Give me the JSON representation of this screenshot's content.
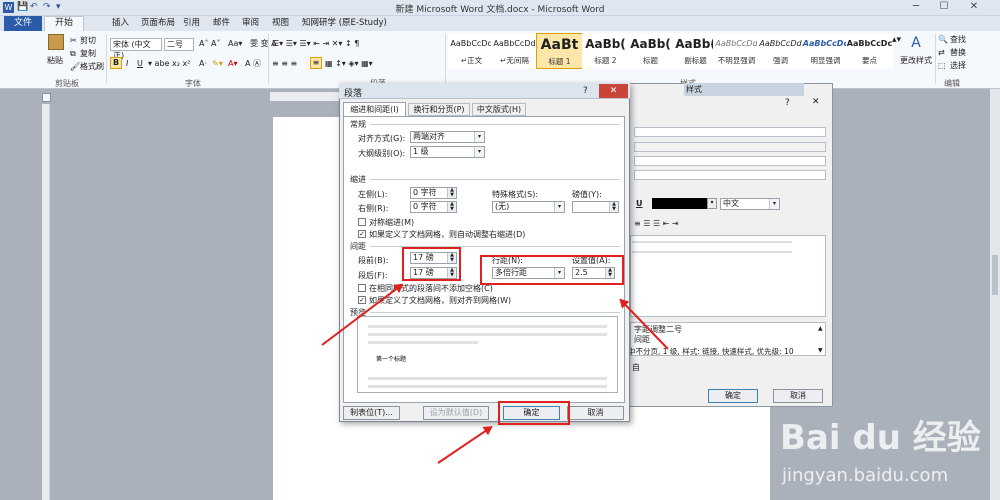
{
  "window": {
    "title": "新建 Microsoft Word 文档.docx - Microsoft Word",
    "app_icon": "W",
    "min": "─",
    "max": "☐",
    "close": "✕"
  },
  "tabs": [
    "文件",
    "开始",
    "插入",
    "页面布局",
    "引用",
    "邮件",
    "审阅",
    "视图",
    "知网研学 (原E-Study)"
  ],
  "ribbon": {
    "clipboard": {
      "paste": "粘贴",
      "cut": "剪切",
      "copy": "复制",
      "format_painter": "格式刷",
      "group": "剪贴板"
    },
    "font": {
      "name": "宋体 (中文正)",
      "size": "二号",
      "group": "字体",
      "bold": "B",
      "italic": "I",
      "underline": "U"
    },
    "paragraph": {
      "group": "段落"
    },
    "styles": {
      "items": [
        {
          "preview": "AaBbCcDd",
          "name": "↵正文"
        },
        {
          "preview": "AaBbCcDd",
          "name": "↵无间隔"
        },
        {
          "preview": "AaBt",
          "name": "标题 1"
        },
        {
          "preview": "AaBb(",
          "name": "标题 2"
        },
        {
          "preview": "AaBb(",
          "name": "标题"
        },
        {
          "preview": "AaBb(",
          "name": "副标题"
        },
        {
          "preview": "AaBbCcDd",
          "name": "不明显强调"
        },
        {
          "preview": "AaBbCcDd",
          "name": "强调"
        },
        {
          "preview": "AaBbCcDc",
          "name": "明显强调"
        },
        {
          "preview": "AaBbCcDc",
          "name": "要点"
        }
      ],
      "change": "更改样式",
      "group": "样式"
    },
    "editing": {
      "find": "查找",
      "replace": "替换",
      "select": "选择",
      "group": "编辑"
    }
  },
  "dialog": {
    "title": "段落",
    "help": "?",
    "tabs": [
      "缩进和间距(I)",
      "换行和分页(P)",
      "中文版式(H)"
    ],
    "general": {
      "section": "常规",
      "alignment_label": "对齐方式(G):",
      "alignment_value": "两端对齐",
      "outline_label": "大纲级别(O):",
      "outline_value": "1 级"
    },
    "indent": {
      "section": "缩进",
      "left_label": "左侧(L):",
      "left_value": "0 字符",
      "right_label": "右侧(R):",
      "right_value": "0 字符",
      "special_label": "特殊格式(S):",
      "special_value": "(无)",
      "by_label": "磅值(Y):",
      "by_value": "",
      "mirror": "对称缩进(M)",
      "auto_adjust": "如果定义了文档网格，则自动调整右缩进(D)"
    },
    "spacing": {
      "section": "间距",
      "before_label": "段前(B):",
      "before_value": "17 磅",
      "after_label": "段后(F):",
      "after_value": "17 磅",
      "line_label": "行距(N):",
      "line_value": "多倍行距",
      "at_label": "设置值(A):",
      "at_value": "2.5",
      "no_space": "在相同样式的段落间不添加空格(C)",
      "snap_grid": "如果定义了文档网格，则对齐到网格(W)"
    },
    "preview": {
      "section": "预览",
      "sample": "第一个标题"
    },
    "tabs_button": "制表位(T)...",
    "default_button": "设为默认值(D)",
    "ok": "确定",
    "cancel": "取消"
  },
  "dialog2": {
    "panel_title": "样式",
    "help": "?",
    "lang": "中文",
    "desc1": "字距调整二号",
    "desc2": "间距",
    "desc3": "中不分页, 1 级, 样式: 链接, 快速样式, 优先级: 10",
    "desc4": "自",
    "ok": "确定",
    "cancel": "取消"
  },
  "watermark": {
    "brand": "Bai du 经验",
    "url": "jingyan.baidu.com"
  },
  "colors": {
    "accent": "#2a5aa8",
    "highlight": "#e0201c"
  }
}
